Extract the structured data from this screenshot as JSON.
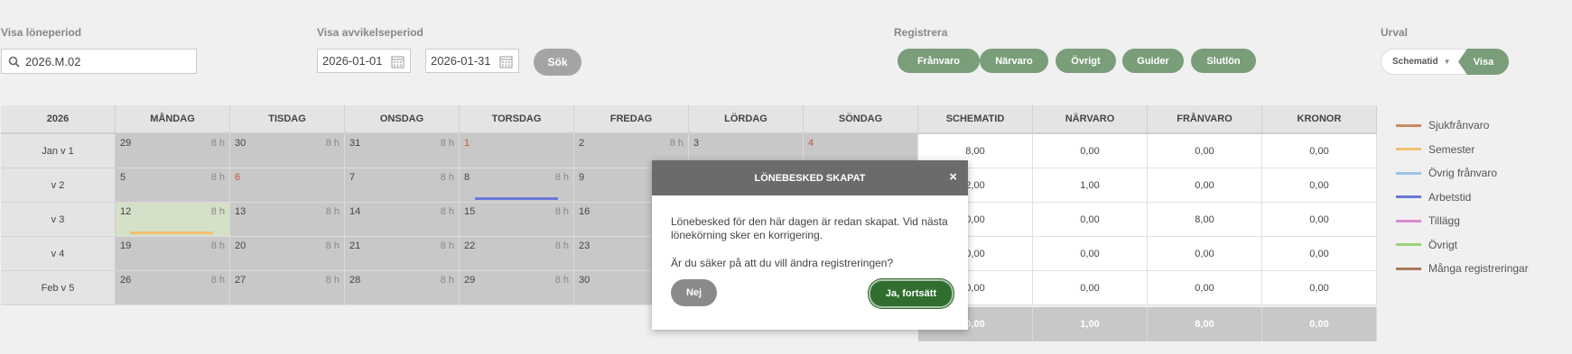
{
  "top": {
    "loneperiod_label": "Visa löneperiod",
    "loneperiod_value": "2026.M.02",
    "avvikelse_label": "Visa avvikelseperiod",
    "date_from": "2026-01-01",
    "date_to": "2026-01-31",
    "search_button": "Sök",
    "registrera_label": "Registrera",
    "registrera_buttons": [
      "Frånvaro",
      "Närvaro",
      "Övrigt",
      "Guider",
      "Slutlön"
    ],
    "urval_label": "Urval",
    "urval_select": "Schematid",
    "urval_button": "Visa"
  },
  "calendar": {
    "headers": [
      "2026",
      "MÅNDAG",
      "TISDAG",
      "ONSDAG",
      "TORSDAG",
      "FREDAG",
      "LÖRDAG",
      "SÖNDAG"
    ],
    "weeks": [
      "Jan v 1",
      "v 2",
      "v 3",
      "v 4",
      "Feb v 5"
    ],
    "hours_label": "8 h",
    "days": [
      [
        "29",
        "30",
        "31",
        "1",
        "2",
        "3",
        "4"
      ],
      [
        "5",
        "6",
        "7",
        "8",
        "9",
        "",
        ""
      ],
      [
        "12",
        "13",
        "14",
        "15",
        "16",
        "",
        ""
      ],
      [
        "19",
        "20",
        "21",
        "22",
        "23",
        "",
        ""
      ],
      [
        "26",
        "27",
        "28",
        "29",
        "30",
        "",
        ""
      ]
    ]
  },
  "summary": {
    "headers": [
      "SCHEMATID",
      "NÄRVARO",
      "FRÅNVARO",
      "KRONOR"
    ],
    "rows": [
      [
        "8,00",
        "0,00",
        "0,00",
        "0,00"
      ],
      [
        "2,00",
        "1,00",
        "0,00",
        "0,00"
      ],
      [
        "0,00",
        "0,00",
        "8,00",
        "0,00"
      ],
      [
        "0,00",
        "0,00",
        "0,00",
        "0,00"
      ],
      [
        "0,00",
        "0,00",
        "0,00",
        "0,00"
      ]
    ],
    "totals": [
      "0,00",
      "1,00",
      "8,00",
      "0,00"
    ]
  },
  "legend": [
    {
      "label": "Sjukfrånvaro",
      "color": "#c98a5e"
    },
    {
      "label": "Semester",
      "color": "#f0c070"
    },
    {
      "label": "Övrig frånvaro",
      "color": "#9cc3e8"
    },
    {
      "label": "Arbetstid",
      "color": "#6a78d6"
    },
    {
      "label": "Tillägg",
      "color": "#d98ad0"
    },
    {
      "label": "Övrigt",
      "color": "#9ed37a"
    },
    {
      "label": "Många registreringar",
      "color": "#a9775a"
    }
  ],
  "modal": {
    "title": "LÖNEBESKED SKAPAT",
    "message1": "Lönebesked för den här dagen är redan skapat. Vid nästa lönekörning sker en korrigering.",
    "message2": "Är du säker på att du vill ändra registreringen?",
    "no_button": "Nej",
    "yes_button": "Ja, fortsätt"
  }
}
